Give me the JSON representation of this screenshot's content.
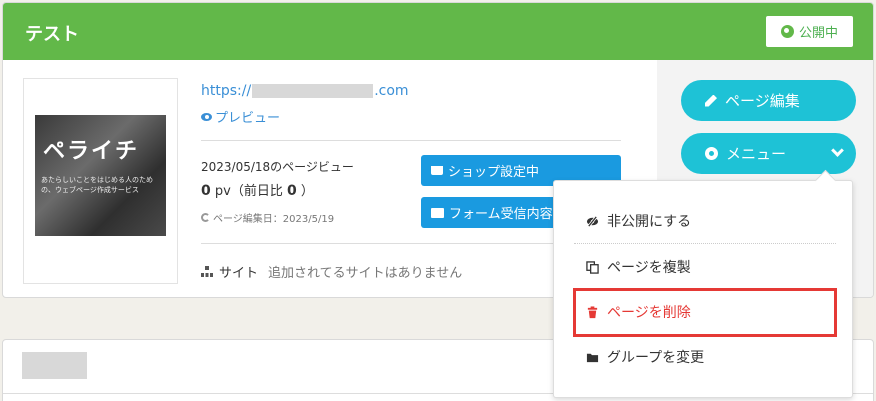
{
  "page": {
    "title": "テスト",
    "status": "公開中",
    "url_prefix": "https://",
    "url_suffix": ".com",
    "preview_label": "プレビュー",
    "thumbnail": {
      "title": "ペライチ",
      "subtitle": "あたらしいことをはじめる人のための、ウェブページ作成サービス"
    },
    "pv": {
      "date_label": "2023/05/18のページビュー",
      "count": "0",
      "unit": "pv（前日比",
      "diff": "0",
      "close": "）"
    },
    "edited": "ページ編集日：2023/5/19",
    "shop_button": "ショップ設定中",
    "form_button": "フォーム受信内容",
    "site_label": "サイト",
    "site_empty": "追加されてるサイトはありません"
  },
  "actions": {
    "edit_button": "ページ編集",
    "menu_button": "メニュー"
  },
  "menu": {
    "items": [
      {
        "label": "非公開にする",
        "icon": "eye-slash-icon"
      },
      {
        "label": "ページを複製",
        "icon": "copy-icon"
      },
      {
        "label": "ページを削除",
        "icon": "trash-icon"
      },
      {
        "label": "グループを変更",
        "icon": "folder-icon"
      }
    ]
  },
  "colors": {
    "header": "#62b849",
    "action": "#1ec2d6",
    "link": "#3a8fd6",
    "danger": "#e53935",
    "button_blue": "#1a9ae0"
  }
}
